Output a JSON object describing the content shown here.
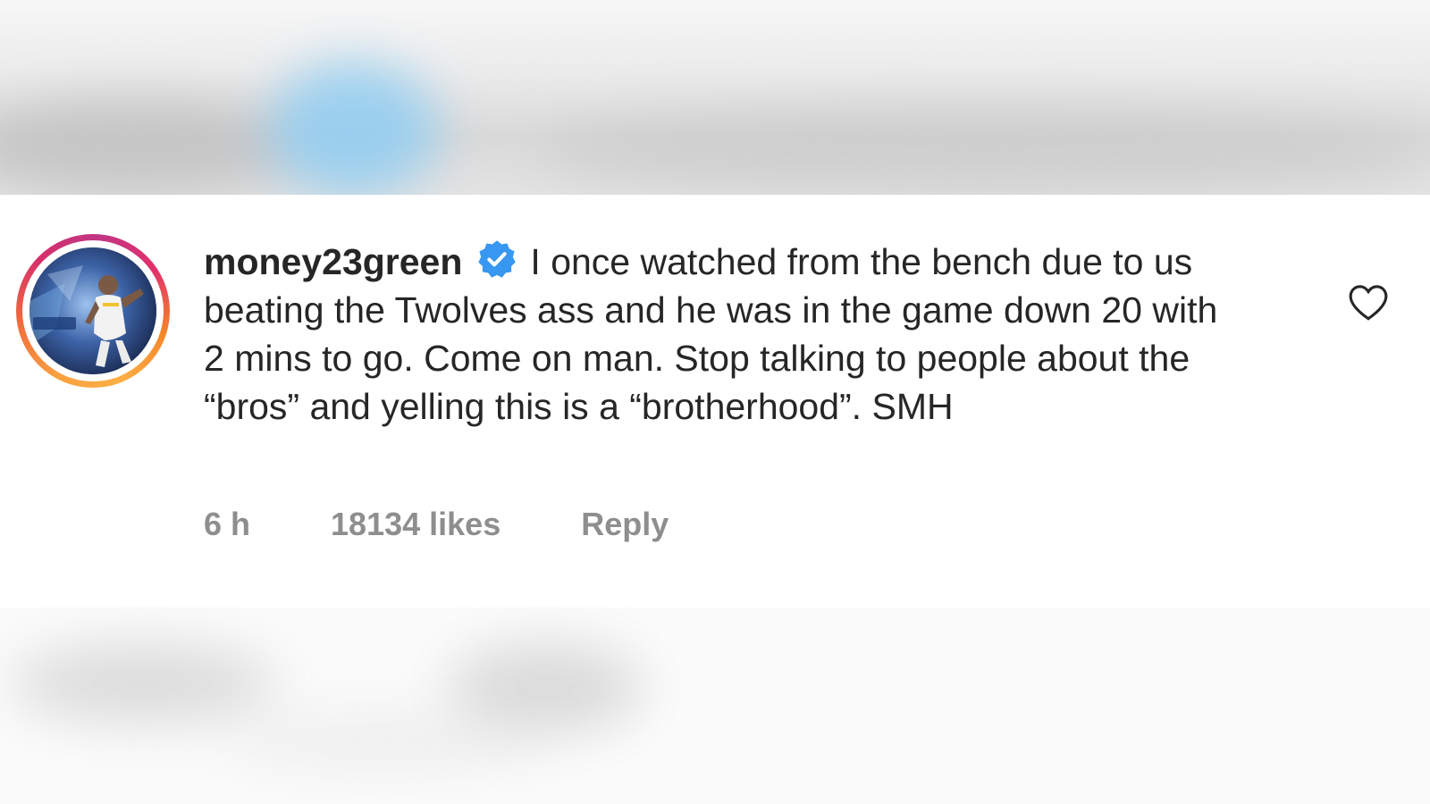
{
  "comment": {
    "username": "money23green",
    "verified": true,
    "text": "I once watched from the bench due to us beating the Twolves ass and he was in the game down 20 with 2 mins to go. Come on man. Stop talking to people about the “bros” and yelling this is a “brotherhood”. SMH",
    "time": "6 h",
    "likes": "18134 likes",
    "reply_label": "Reply"
  },
  "icons": {
    "verified": "verified-badge-icon",
    "like": "heart-icon"
  },
  "colors": {
    "text": "#262626",
    "meta": "#8e8e8e",
    "verified": "#3897f0"
  }
}
